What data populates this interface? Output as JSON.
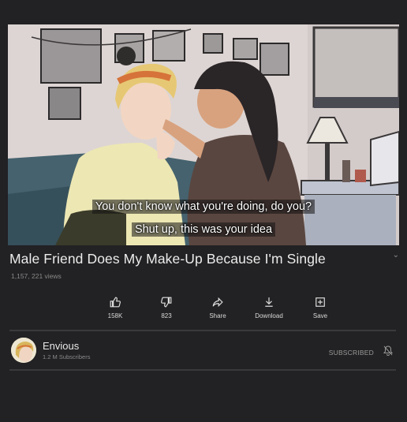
{
  "video": {
    "subtitle_line_1": "You don't know what you're doing, do you?",
    "subtitle_line_2": "Shut up, this was your idea"
  },
  "title": "Male Friend Does My Make-Up Because I'm Single",
  "views": "1,157, 221 views",
  "actions": [
    {
      "label": "158K",
      "icon": "thumbs-up-icon"
    },
    {
      "label": "823",
      "icon": "thumbs-down-icon"
    },
    {
      "label": "Share",
      "icon": "share-icon"
    },
    {
      "label": "Download",
      "icon": "download-icon"
    },
    {
      "label": "Save",
      "icon": "save-icon"
    }
  ],
  "channel": {
    "name": "Envious",
    "subscribers": "1.2 M Subscribers",
    "subscribe_state": "SUBSCRIBED"
  },
  "colors": {
    "background": "#222123",
    "text_primary": "#ececec",
    "text_secondary": "#8a8a8a"
  }
}
